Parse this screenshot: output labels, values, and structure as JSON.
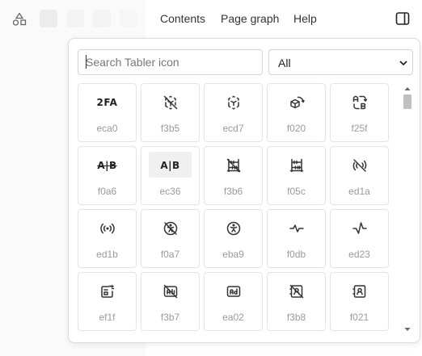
{
  "topbar": {
    "contents_label": "Contents",
    "page_graph_label": "Page graph",
    "help_label": "Help"
  },
  "picker": {
    "search_placeholder": "Search Tabler icon",
    "filter_value": "All"
  },
  "icons": [
    {
      "code": "eca0",
      "glyph": "2FA",
      "icon": "2fa-icon"
    },
    {
      "code": "f3b5",
      "icon": "3d-cube-sphere-off-icon"
    },
    {
      "code": "ecd7",
      "icon": "3d-cube-sphere-icon"
    },
    {
      "code": "f020",
      "icon": "3d-rotate-icon"
    },
    {
      "code": "f25f",
      "icon": "a-b-2-icon"
    },
    {
      "code": "f0a6",
      "glyph": "A|B",
      "icon": "a-b-off-icon"
    },
    {
      "code": "ec36",
      "glyph": "A|B",
      "icon": "a-b-icon"
    },
    {
      "code": "f3b6",
      "icon": "abacus-off-icon"
    },
    {
      "code": "f05c",
      "icon": "abacus-icon"
    },
    {
      "code": "ed1a",
      "icon": "access-point-off-icon"
    },
    {
      "code": "ed1b",
      "icon": "access-point-icon"
    },
    {
      "code": "f0a7",
      "icon": "accessible-off-icon"
    },
    {
      "code": "eba9",
      "icon": "accessible-icon"
    },
    {
      "code": "f0db",
      "icon": "activity-heartbeat-icon"
    },
    {
      "code": "ed23",
      "icon": "activity-icon"
    },
    {
      "code": "ef1f",
      "icon": "ad-2-icon"
    },
    {
      "code": "f3b7",
      "icon": "ad-off-icon"
    },
    {
      "code": "ea02",
      "icon": "ad-icon"
    },
    {
      "code": "f3b8",
      "icon": "address-book-off-icon"
    },
    {
      "code": "f021",
      "icon": "address-book-icon"
    }
  ]
}
